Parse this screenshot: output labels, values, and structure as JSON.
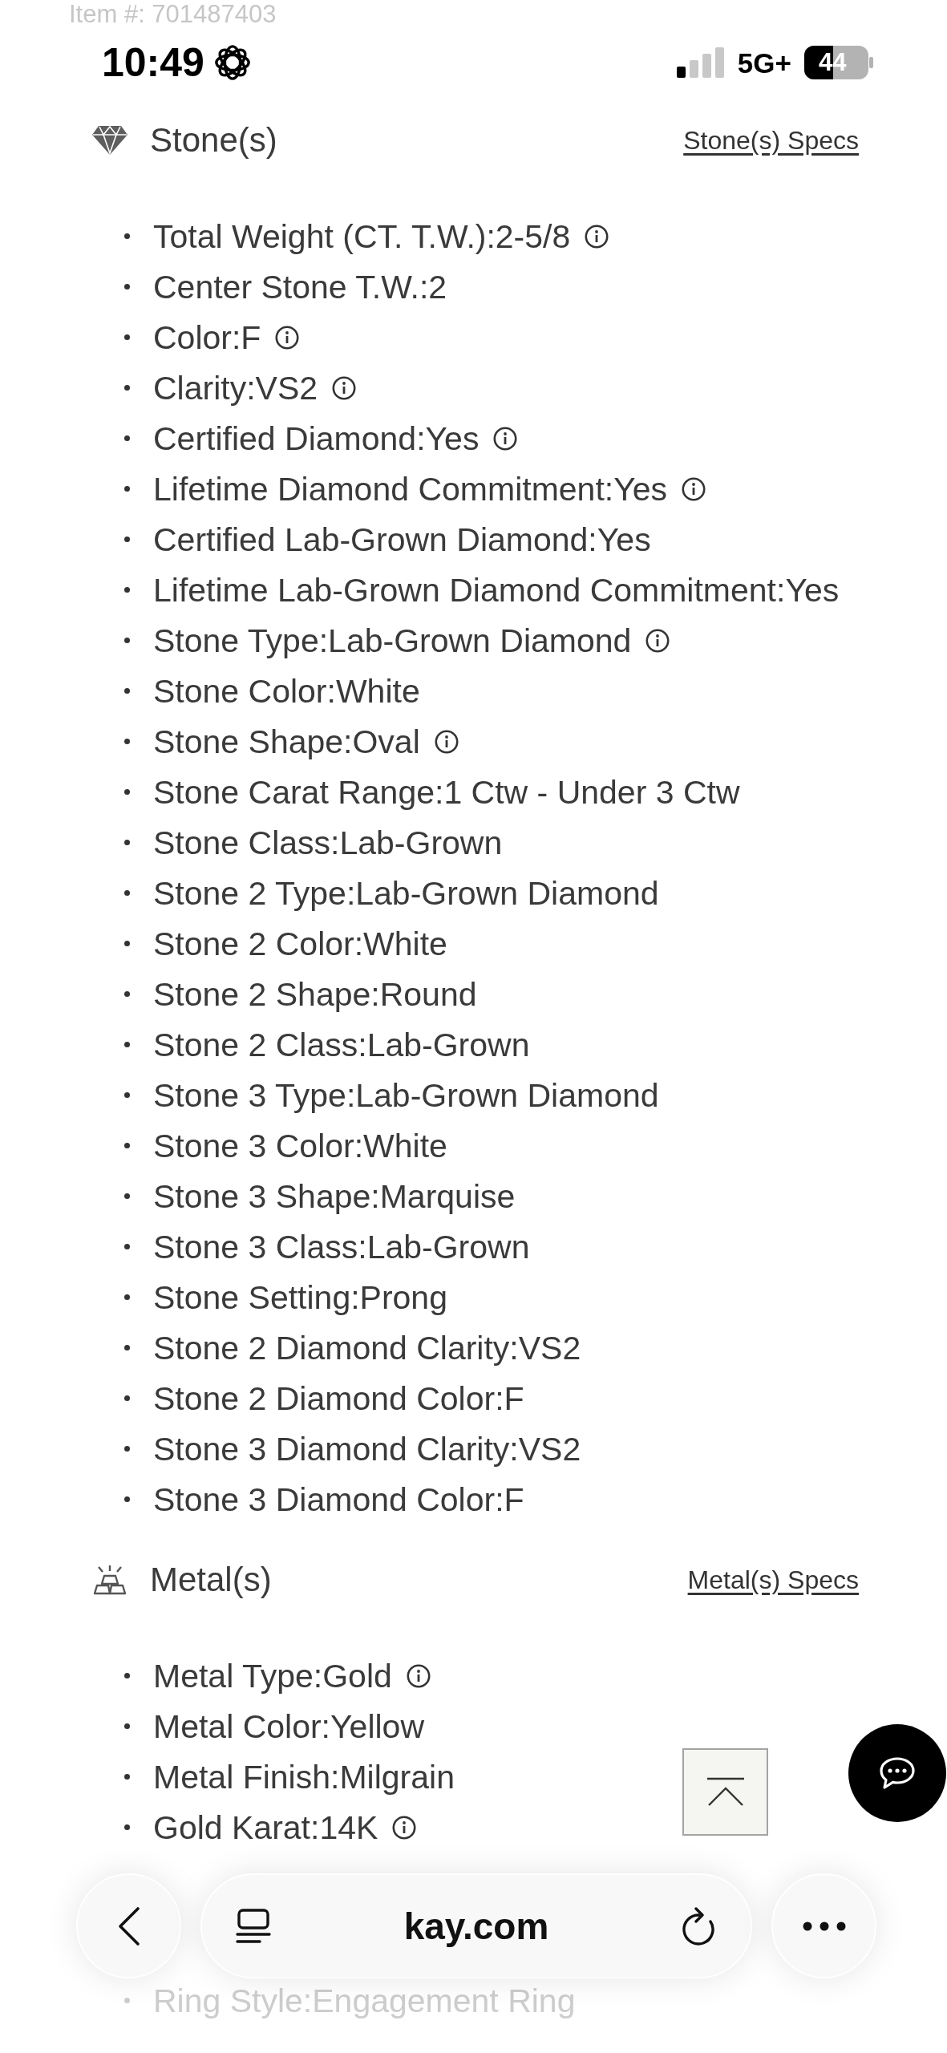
{
  "page_header": {
    "item_number": "Item #: 701487403"
  },
  "status_bar": {
    "time": "10:49",
    "network": "5G+",
    "battery": "44"
  },
  "sections": [
    {
      "kind": "stone",
      "title": "Stone(s)",
      "link": "Stone(s) Specs",
      "items": [
        {
          "text": "Total Weight (CT. T.W.):2-5/8",
          "info": true
        },
        {
          "text": "Center Stone T.W.:2",
          "info": false
        },
        {
          "text": "Color:F",
          "info": true
        },
        {
          "text": "Clarity:VS2",
          "info": true
        },
        {
          "text": "Certified Diamond:Yes",
          "info": true
        },
        {
          "text": "Lifetime Diamond Commitment:Yes",
          "info": true
        },
        {
          "text": "Certified Lab-Grown Diamond:Yes",
          "info": false
        },
        {
          "text": "Lifetime Lab-Grown Diamond Commitment:Yes",
          "info": false
        },
        {
          "text": "Stone Type:Lab-Grown Diamond",
          "info": true
        },
        {
          "text": "Stone Color:White",
          "info": false
        },
        {
          "text": "Stone Shape:Oval",
          "info": true
        },
        {
          "text": "Stone Carat Range:1 Ctw - Under 3 Ctw",
          "info": false
        },
        {
          "text": "Stone Class:Lab-Grown",
          "info": false
        },
        {
          "text": "Stone 2 Type:Lab-Grown Diamond",
          "info": false
        },
        {
          "text": "Stone 2 Color:White",
          "info": false
        },
        {
          "text": "Stone 2 Shape:Round",
          "info": false
        },
        {
          "text": "Stone 2 Class:Lab-Grown",
          "info": false
        },
        {
          "text": "Stone 3 Type:Lab-Grown Diamond",
          "info": false
        },
        {
          "text": "Stone 3 Color:White",
          "info": false
        },
        {
          "text": "Stone 3 Shape:Marquise",
          "info": false
        },
        {
          "text": "Stone 3 Class:Lab-Grown",
          "info": false
        },
        {
          "text": "Stone Setting:Prong",
          "info": false
        },
        {
          "text": "Stone 2 Diamond Clarity:VS2",
          "info": false
        },
        {
          "text": "Stone 2 Diamond Color:F",
          "info": false
        },
        {
          "text": "Stone 3 Diamond Clarity:VS2",
          "info": false
        },
        {
          "text": "Stone 3 Diamond Color:F",
          "info": false
        }
      ]
    },
    {
      "kind": "metal",
      "title": "Metal(s)",
      "link": "Metal(s) Specs",
      "items": [
        {
          "text": "Metal Type:Gold",
          "info": true
        },
        {
          "text": "Metal Color:Yellow",
          "info": false
        },
        {
          "text": "Metal Finish:Milgrain",
          "info": false
        },
        {
          "text": "Gold Karat:14K",
          "info": true
        }
      ]
    },
    {
      "kind": "faded",
      "items": [
        {
          "text": "Ring Style:Engagement Ring",
          "info": false
        }
      ]
    }
  ],
  "browser_bar": {
    "url": "kay.com"
  }
}
